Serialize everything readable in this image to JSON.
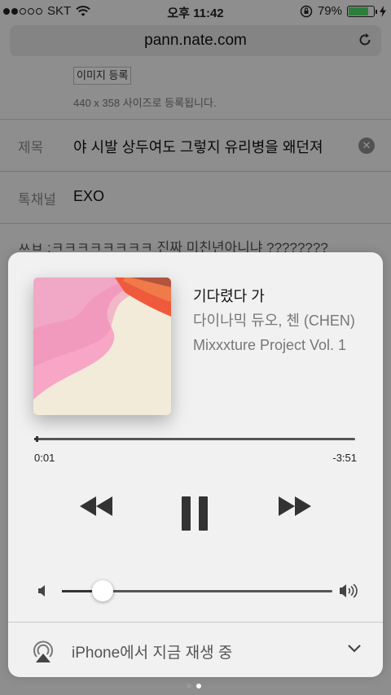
{
  "status_bar": {
    "carrier": "SKT",
    "time": "오후 11:42",
    "battery_percent": "79%",
    "battery_level": 0.79
  },
  "browser": {
    "host": "pann.nate.com",
    "reload_icon": "reload-icon"
  },
  "form": {
    "image_register_label": "이미지 등록",
    "size_note": "440 x 358 사이즈로 등록됩니다.",
    "title_label": "제목",
    "title_value": "야 시발 상두여도 그렇지 유리병을 왜던져",
    "channel_label": "톡채널",
    "channel_value": "EXO",
    "body_text": "ㅆㅂ ;ㅋㅋㅋㅋㅋㅋㅋㅋ 진짜 미친년아니냐 ????????"
  },
  "now_playing": {
    "song_title": "기다렸다 가",
    "artist": "다이나믹 듀오, 첸 (CHEN)",
    "album": "Mixxxture Project Vol. 1",
    "elapsed": "0:01",
    "remaining": "-3:51",
    "progress": 0.004,
    "volume": 0.15,
    "airplay_label": "iPhone에서 지금 재생 중",
    "controls": {
      "prev_icon": "rewind-icon",
      "play_icon": "pause-icon",
      "next_icon": "fast-forward-icon"
    }
  },
  "page_indicator": {
    "count": 2,
    "active": 1
  },
  "colors": {
    "card_background": "#f1f1f1",
    "accent_dark": "#333333",
    "battery_green": "#4cd964"
  }
}
